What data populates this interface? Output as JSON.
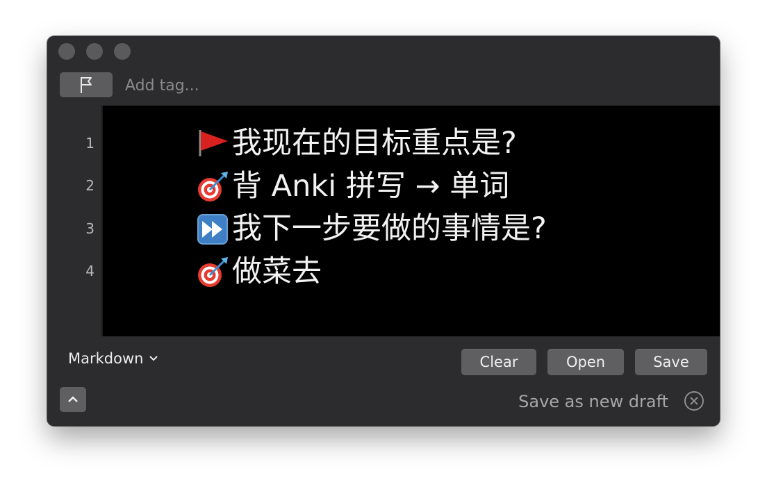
{
  "tags": {
    "placeholder": "Add tag..."
  },
  "editor": {
    "lines": [
      {
        "num": "1",
        "text": "我现在的目标重点是?"
      },
      {
        "num": "2",
        "text": " 背 Anki 拼写 → 单词"
      },
      {
        "num": "3",
        "text": "我下一步要做的事情是?"
      },
      {
        "num": "4",
        "text": " 做菜去"
      }
    ]
  },
  "bottom": {
    "mode": "Markdown",
    "clear": "Clear",
    "open": "Open",
    "save": "Save",
    "draft": "Save as new draft"
  },
  "icons": {
    "line1": "red-flag-icon",
    "line2": "direct-hit-icon",
    "line3": "fast-forward-icon",
    "line4": "direct-hit-icon"
  },
  "colors": {
    "window_bg": "#2c2c2e",
    "editor_bg": "#000000",
    "button_bg": "#5f5f61",
    "text": "#f2f2f2"
  }
}
